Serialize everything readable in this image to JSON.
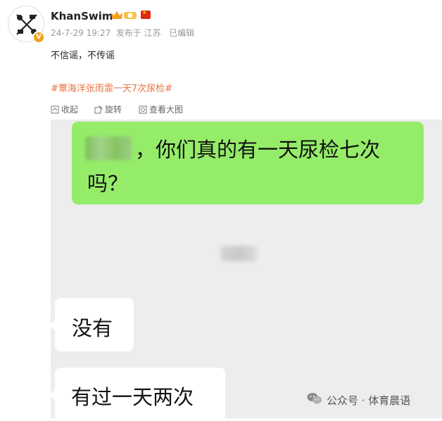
{
  "post": {
    "username": "KhanSwim",
    "meta": "24-7-29 19:27  发布于 江苏   已编辑",
    "text": "不信谣，不传谣",
    "hashtag": "#覃海洋张雨霏一天7次尿检#",
    "icons": {
      "avatar": "avatar",
      "verified": "verified-badge-icon",
      "crown": "vip-crown-icon",
      "flag": "china-flag-icon"
    },
    "verified_mark": "V"
  },
  "toolbar": [
    {
      "label": "收起",
      "icon": "collapse-icon"
    },
    {
      "label": "旋转",
      "icon": "rotate-icon"
    },
    {
      "label": "查看大图",
      "icon": "view-large-icon"
    }
  ],
  "chat": {
    "sent": {
      "line1": "，你们真的有一天尿检七次",
      "line2": "吗？"
    },
    "replies": [
      "没有",
      "有过一天两次"
    ]
  },
  "watermark": {
    "text": "公众号 · 体育晨语",
    "icon": "wechat-icon"
  },
  "colors": {
    "green_bubble": "#95ec69",
    "chat_bg": "#ededed",
    "hashtag": "#eb7340",
    "vip": "#f4a01f"
  }
}
